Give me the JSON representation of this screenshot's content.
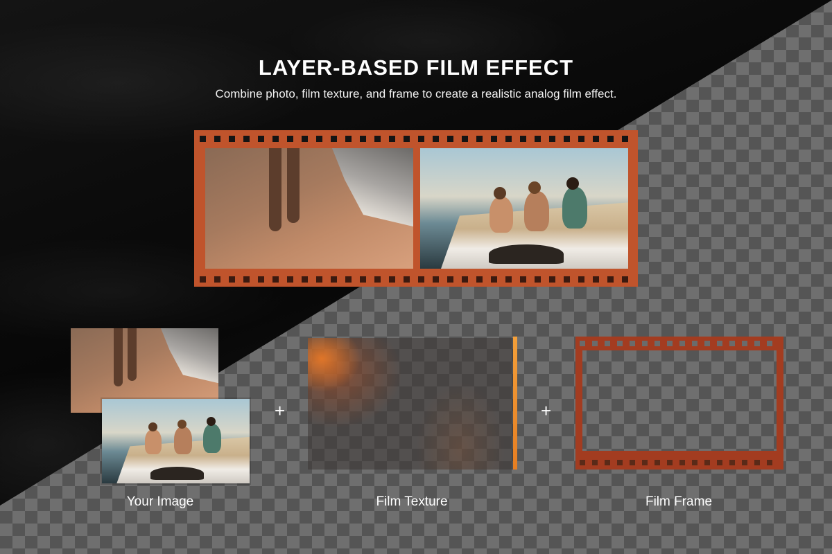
{
  "header": {
    "title": "LAYER-BASED FILM EFFECT",
    "subtitle": "Combine photo, film texture, and frame to create a realistic analog film effect."
  },
  "layers": {
    "image_label": "Your Image",
    "texture_label": "Film Texture",
    "frame_label": "Film Frame",
    "plus": "+"
  },
  "colors": {
    "film_orange": "#c0542c",
    "frame_rust": "#a33c20",
    "texture_accent": "#f4a03a",
    "background_dark": "#0b0b0b"
  }
}
